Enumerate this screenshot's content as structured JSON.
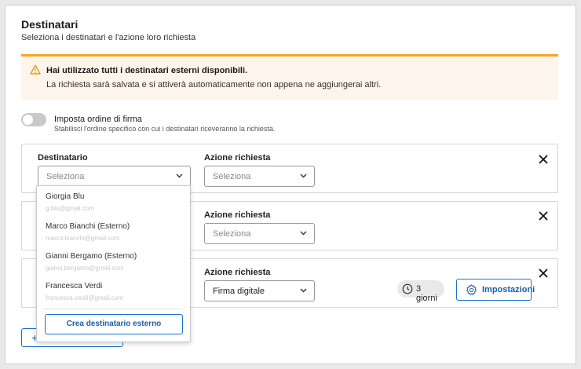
{
  "header": {
    "title": "Destinatari",
    "subtitle": "Seleziona i destinatari e l'azione loro richiesta"
  },
  "warning": {
    "heading": "Hai utilizzato tutti i destinatari esterni disponibili.",
    "body": "La richiesta sarà salvata e si attiverà automaticamente non appena ne aggiungerai altri.",
    "accent_color": "#f5a623",
    "icon": "warning-triangle-icon"
  },
  "signing_order": {
    "label": "Imposta ordine di firma",
    "description": "Stabilisci l'ordine specifico con cui i destinatari riceveranno la richiesta.",
    "enabled": false
  },
  "recipients": [
    {
      "recipient_label": "Destinatario",
      "recipient_value": "Seleziona",
      "action_label": "Azione richiesta",
      "action_value": "Seleziona"
    },
    {
      "action_label": "Azione richiesta",
      "action_value": "Seleziona"
    },
    {
      "action_label": "Azione richiesta",
      "action_value": "Firma digitale",
      "timer_label": "3 giorni",
      "settings_label": "Impostazioni"
    }
  ],
  "dropdown": {
    "options": [
      {
        "name": "Giorgia Blu",
        "email": "g.blu@gmail.com"
      },
      {
        "name": "Marco Bianchi (Esterno)",
        "email": "marco.bianchi@gmail.com"
      },
      {
        "name": "Gianni Bergamo (Esterno)",
        "email": "gianni.bergamo@gmail.com"
      },
      {
        "name": "Francesca Verdi",
        "email": "francesca.verdi@gmail.com"
      }
    ],
    "create_label": "Crea destinatario esterno"
  },
  "add_button": {
    "icon": "plus-icon"
  },
  "colors": {
    "primary": "#1a73c9",
    "warning_bg": "#fdf5eb"
  }
}
